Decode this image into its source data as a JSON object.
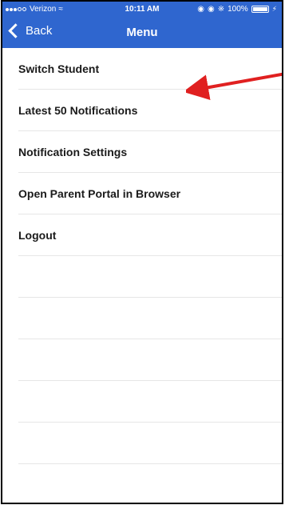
{
  "status_bar": {
    "carrier": "Verizon",
    "time": "10:11 AM",
    "battery": "100%"
  },
  "nav": {
    "back_label": "Back",
    "title": "Menu"
  },
  "menu": {
    "items": [
      {
        "label": "Switch Student"
      },
      {
        "label": "Latest 50 Notifications"
      },
      {
        "label": "Notification Settings"
      },
      {
        "label": "Open Parent Portal in Browser"
      },
      {
        "label": "Logout"
      }
    ]
  },
  "colors": {
    "accent": "#2f66cf",
    "annotation_arrow": "#e02020"
  }
}
